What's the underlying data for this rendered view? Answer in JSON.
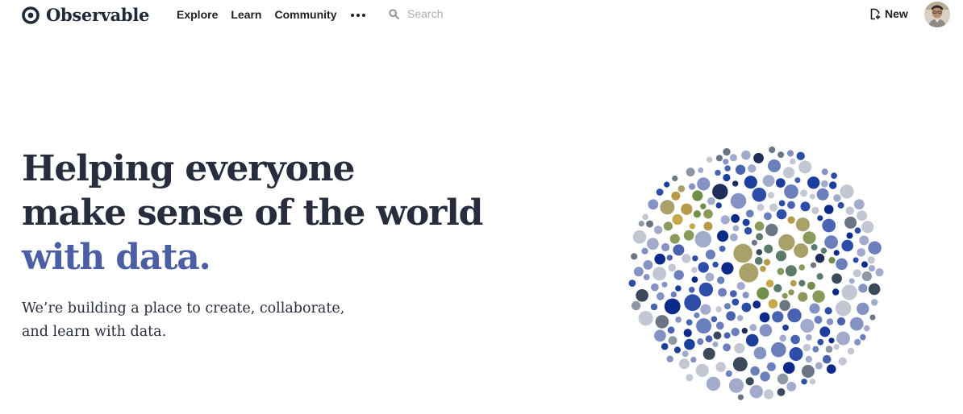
{
  "header": {
    "logo_text": "Observable",
    "nav": [
      {
        "label": "Explore"
      },
      {
        "label": "Learn"
      },
      {
        "label": "Community"
      }
    ],
    "more_icon": "more-horizontal-icon",
    "search": {
      "placeholder": "Search",
      "icon": "search-icon"
    },
    "new_button": {
      "label": "New",
      "icon": "new-notebook-icon"
    },
    "avatar_icon": "user-avatar"
  },
  "hero": {
    "title_line1": "Helping everyone",
    "title_line2": "make sense of the world",
    "title_accent": "with data.",
    "subtitle_line1": "We’re building a place to create, collaborate,",
    "subtitle_line2": "and learn with data."
  },
  "colors": {
    "heading": "#282d3e",
    "accent": "#4c5fa5",
    "text": "#1b1e23",
    "placeholder": "#a9adb3",
    "bubble_palette": [
      "#0b2a8a",
      "#1c3f9e",
      "#2c4da8",
      "#4a63b0",
      "#6b7fbd",
      "#8593c4",
      "#a3abcc",
      "#c3c7d4",
      "#8e98a4",
      "#6a7683",
      "#5a7a6a",
      "#6f8f4a",
      "#8a9a5a",
      "#a9a06a",
      "#b89a4a",
      "#c4a84a",
      "#1e2d5a",
      "#3a4a5a"
    ]
  }
}
